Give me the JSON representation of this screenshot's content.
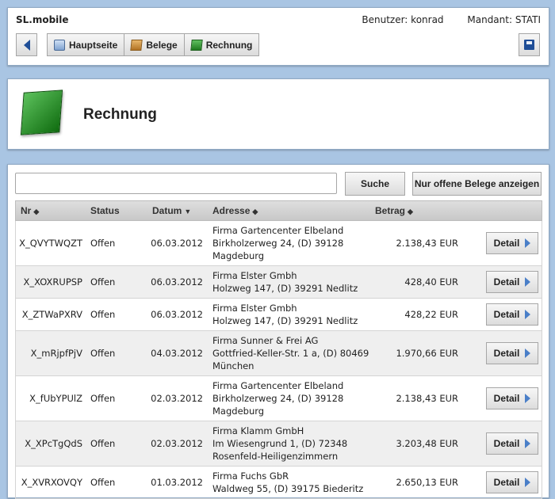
{
  "header": {
    "app_name": "SL.mobile",
    "user_label": "Benutzer: konrad",
    "client_label": "Mandant: STATI",
    "crumbs": [
      "Hauptseite",
      "Belege",
      "Rechnung"
    ]
  },
  "page": {
    "title": "Rechnung"
  },
  "toolbar": {
    "search_placeholder": "",
    "search_label": "Suche",
    "open_only_label": "Nur offene Belege anzeigen"
  },
  "table": {
    "columns": [
      "Nr",
      "Status",
      "Datum",
      "Adresse",
      "Betrag"
    ],
    "sort_icons": [
      "◆",
      "",
      "▼",
      "◆",
      "◆"
    ],
    "detail_label": "Detail",
    "rows": [
      {
        "nr": "X_QVYTWQZT",
        "status": "Offen",
        "date": "06.03.2012",
        "company": "Firma Gartencenter Elbeland",
        "street": "Birkholzerweg 24, (D) 39128",
        "city": "Magdeburg",
        "amount": "2.138,43 EUR"
      },
      {
        "nr": "X_XOXRUPSP",
        "status": "Offen",
        "date": "06.03.2012",
        "company": "Firma Elster Gmbh",
        "street": "Holzweg 147, (D) 39291 Nedlitz",
        "city": "",
        "amount": "428,40 EUR"
      },
      {
        "nr": "X_ZTWaPXRV",
        "status": "Offen",
        "date": "06.03.2012",
        "company": "Firma Elster Gmbh",
        "street": "Holzweg 147, (D) 39291 Nedlitz",
        "city": "",
        "amount": "428,22 EUR"
      },
      {
        "nr": "X_mRjpfPjV",
        "status": "Offen",
        "date": "04.03.2012",
        "company": "Firma Sunner & Frei AG",
        "street": "Gottfried-Keller-Str. 1 a, (D) 80469",
        "city": "München",
        "amount": "1.970,66 EUR"
      },
      {
        "nr": "X_fUbYPUlZ",
        "status": "Offen",
        "date": "02.03.2012",
        "company": "Firma Gartencenter Elbeland",
        "street": "Birkholzerweg 24, (D) 39128",
        "city": "Magdeburg",
        "amount": "2.138,43 EUR"
      },
      {
        "nr": "X_XPcTgQdS",
        "status": "Offen",
        "date": "02.03.2012",
        "company": "Firma Klamm GmbH",
        "street": "Im Wiesengrund 1, (D) 72348",
        "city": "Rosenfeld-Heiligenzimmern",
        "amount": "3.203,48 EUR"
      },
      {
        "nr": "X_XVRXOVQY",
        "status": "Offen",
        "date": "01.03.2012",
        "company": "Firma Fuchs GbR",
        "street": "Waldweg 55, (D) 39175 Biederitz",
        "city": "",
        "amount": "2.650,13 EUR"
      }
    ]
  }
}
